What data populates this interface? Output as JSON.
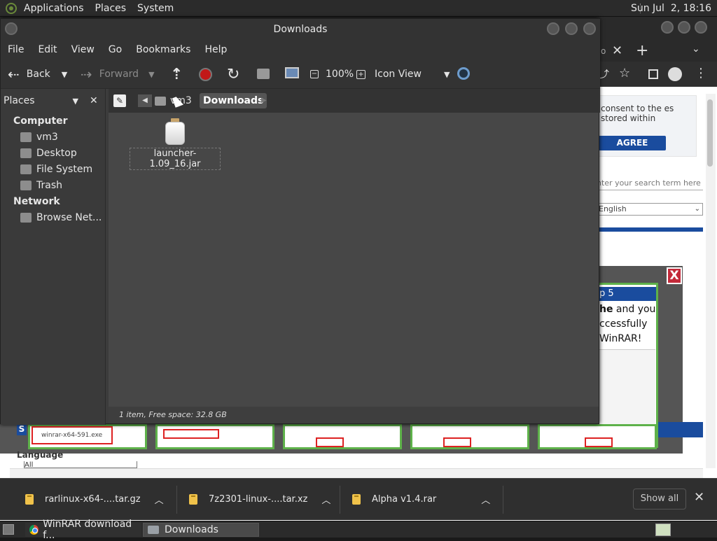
{
  "top_panel": {
    "menus": [
      "Applications",
      "Places",
      "System"
    ],
    "clock": "Sun Jul  2, 18:16"
  },
  "browser": {
    "consent_text": "consent to the es stored within",
    "agree_button": "AGREE",
    "search_placeholder": "nter your search term here",
    "language_value": "English",
    "step_header": "p 5",
    "step_text_bold": "he",
    "step_text": " and you ccessfully WinRAR!",
    "close_overlay": "X",
    "exe_name": "winrar-x64-591.exe",
    "s_label": "S",
    "language_label": "Language",
    "language_select_value": "All"
  },
  "downloads_bar": {
    "items": [
      {
        "name": "rarlinux-x64-....tar.gz"
      },
      {
        "name": "7z2301-linux-....tar.xz"
      },
      {
        "name": "Alpha v1.4.rar"
      }
    ],
    "show_all": "Show all"
  },
  "taskbar": {
    "tasks": [
      "WinRAR download f...",
      "Downloads"
    ]
  },
  "file_manager": {
    "title": "Downloads",
    "menu": [
      "File",
      "Edit",
      "View",
      "Go",
      "Bookmarks",
      "Help"
    ],
    "toolbar": {
      "back": "Back",
      "forward": "Forward",
      "zoom": "100%",
      "view_mode": "Icon View"
    },
    "sidebar": {
      "header": "Places",
      "sections": [
        {
          "title": "Computer",
          "items": [
            "vm3",
            "Desktop",
            "File System",
            "Trash"
          ]
        },
        {
          "title": "Network",
          "items": [
            "Browse Net..."
          ]
        }
      ]
    },
    "path": [
      "vm3",
      "Downloads"
    ],
    "files": [
      {
        "name": "launcher-1.09_16.jar"
      }
    ],
    "status": "1 item, Free space: 32.8 GB"
  }
}
